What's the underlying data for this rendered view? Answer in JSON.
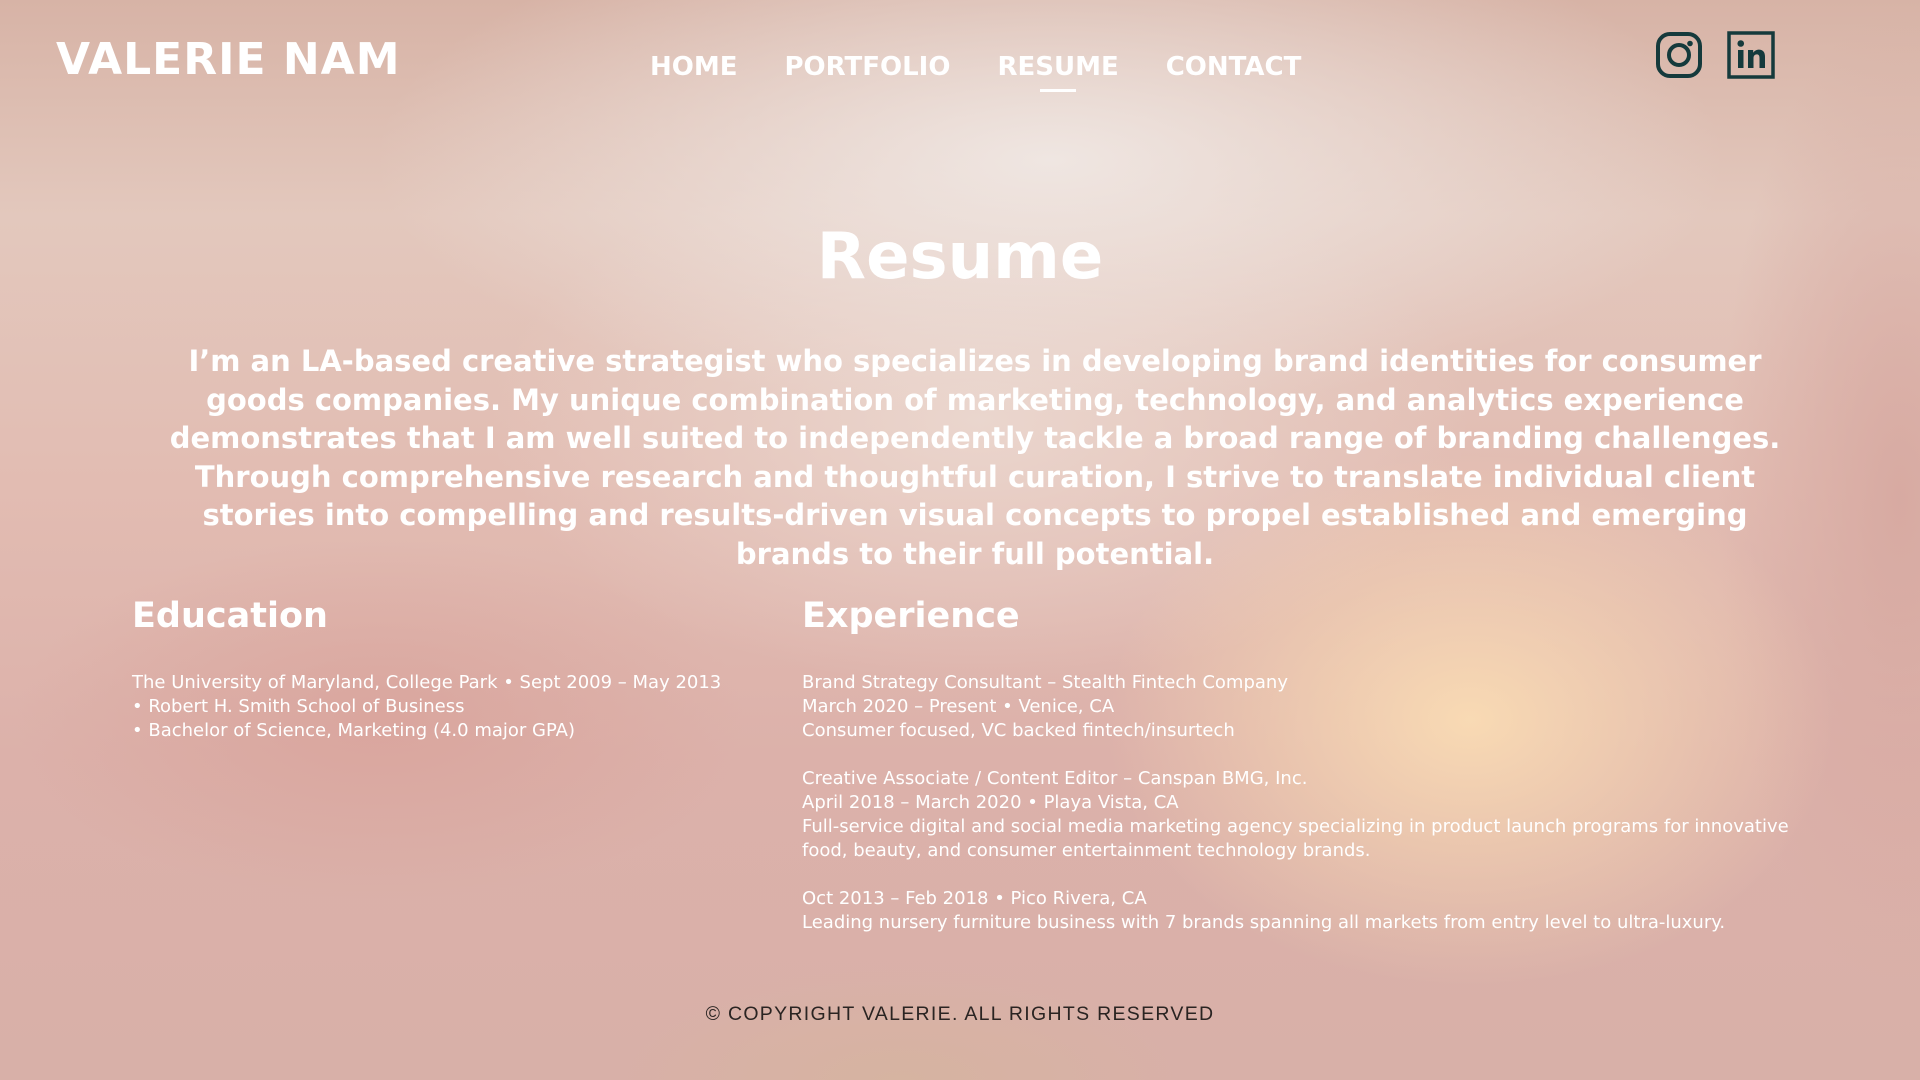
{
  "header": {
    "logo": "VALERIE NAM",
    "nav": [
      {
        "label": "HOME",
        "active": false
      },
      {
        "label": "PORTFOLIO",
        "active": false
      },
      {
        "label": "RESUME",
        "active": true
      },
      {
        "label": "CONTACT",
        "active": false
      }
    ],
    "socials": [
      {
        "icon": "instagram-icon"
      },
      {
        "icon": "linkedin-icon"
      }
    ]
  },
  "main": {
    "title": "Resume",
    "intro": "I’m an LA-based creative strategist who specializes in developing brand identities for consumer goods companies. My unique combination of marketing, technology, and analytics experience demonstrates that I am well suited to independently tackle a broad range of branding challenges. Through comprehensive research and thoughtful curation, I strive to translate individual client stories into compelling and results-driven visual concepts to propel established and emerging brands to their full potential.",
    "education": {
      "heading": "Education",
      "lines": [
        "The University of Maryland, College Park • Sept 2009 – May 2013",
        "• Robert H. Smith School of Business",
        "• Bachelor of Science, Marketing (4.0 major GPA)"
      ]
    },
    "experience": {
      "heading": "Experience",
      "jobs": [
        {
          "title": "Brand Strategy Consultant – Stealth Fintech Company",
          "dates": "March 2020 – Present • Venice, CA",
          "description": "Consumer focused, VC backed fintech/insurtech"
        },
        {
          "title": "Creative Associate / Content Editor – Canspan BMG, Inc.",
          "dates": "April 2018 – March 2020 • Playa Vista, CA",
          "description": "Full-service digital and social media marketing agency specializing in product launch programs for innovative food, beauty, and consumer entertainment technology brands."
        },
        {
          "dates": "Oct 2013 – Feb 2018 • Pico Rivera, CA",
          "description": "Leading nursery furniture business with 7 brands spanning all markets from entry level to ultra-luxury."
        }
      ]
    }
  },
  "footer": {
    "copyright": "© COPYRIGHT VALERIE. ALL RIGHTS RESERVED"
  },
  "colors": {
    "text": "#ffffff",
    "icon": "#153a3c",
    "footer_text": "#2a2422"
  }
}
